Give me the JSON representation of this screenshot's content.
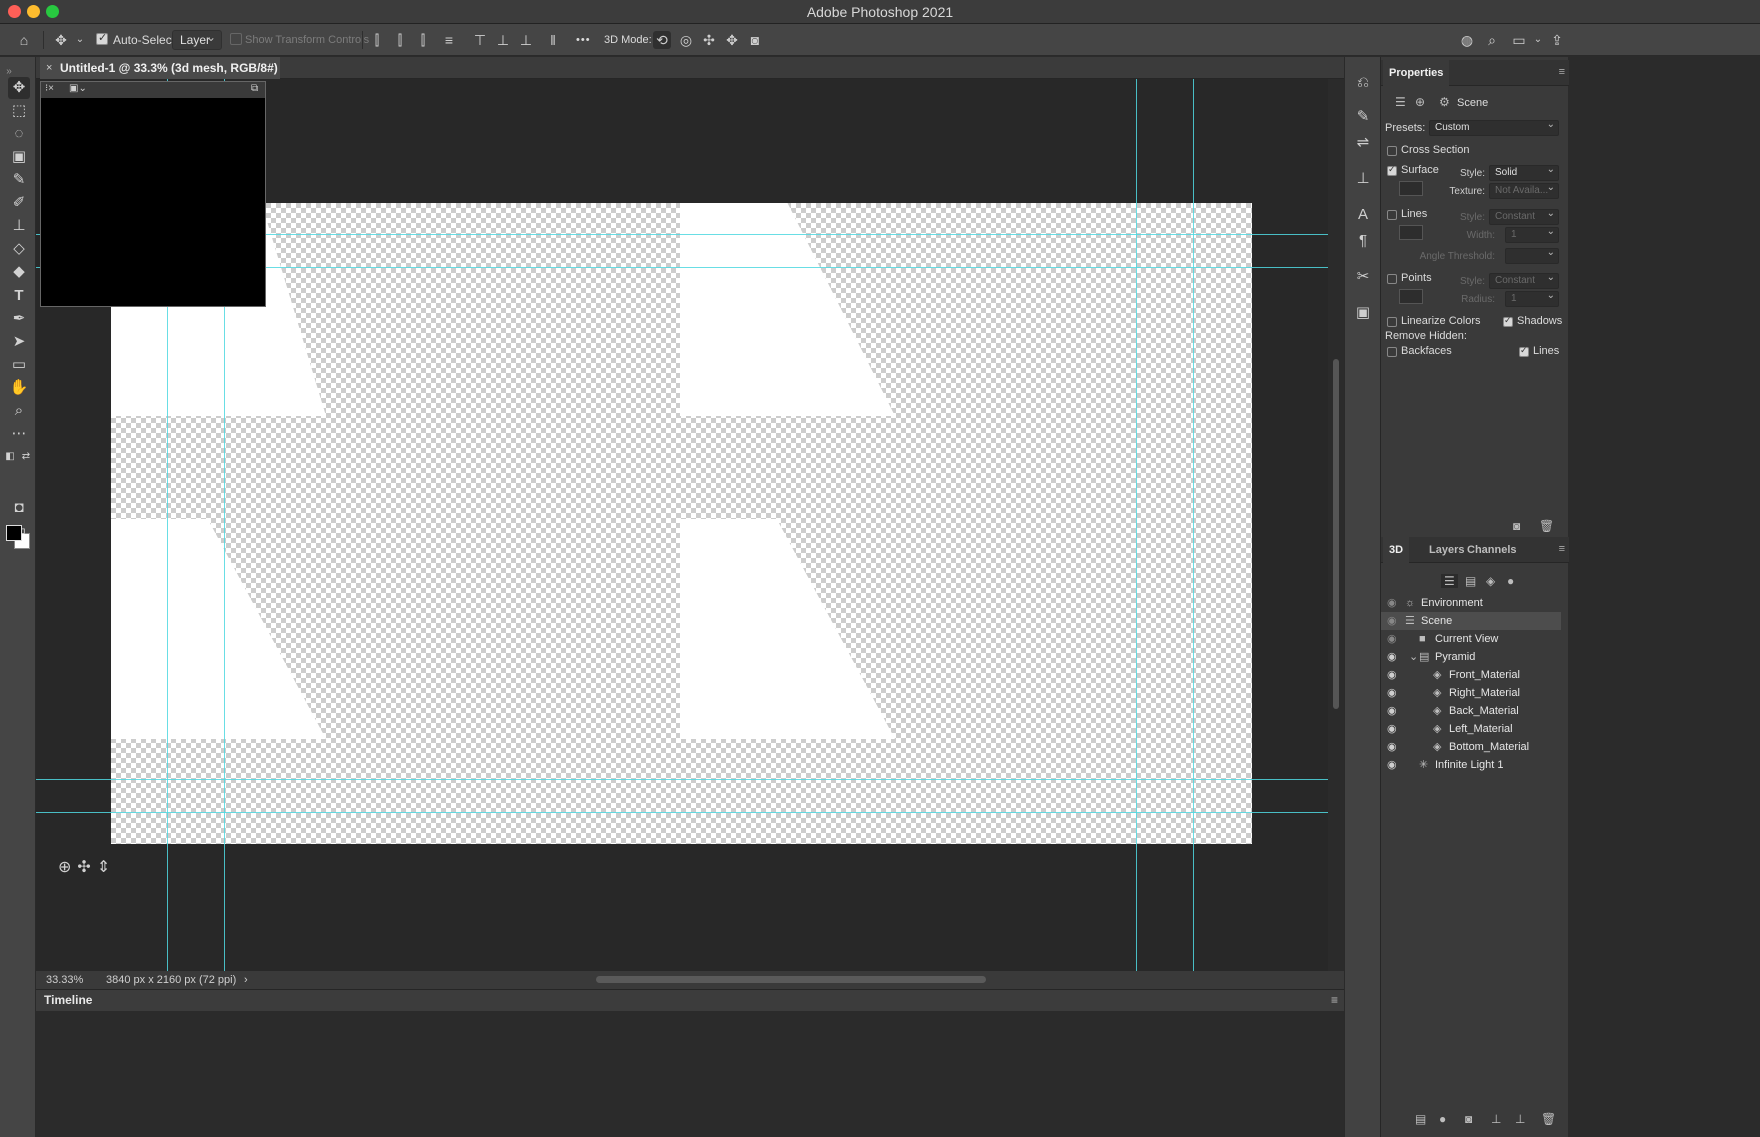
{
  "app_title": "Adobe Photoshop 2021",
  "options_bar": {
    "auto_select_label": "Auto-Select:",
    "auto_select_value": "Layer",
    "show_transform_label": "Show Transform Controls",
    "more_label": "•••",
    "mode_3d_label": "3D Mode:"
  },
  "document": {
    "tab_title": "Untitled-1 @ 33.3% (3d mesh, RGB/8#) *",
    "zoom": "33.33%",
    "size": "3840 px x 2160 px (72 ppi)",
    "status_arrow": "›"
  },
  "timeline": {
    "label": "Timeline",
    "menu": "≡"
  },
  "properties": {
    "tab": "Properties",
    "scene_label": "Scene",
    "presets_label": "Presets:",
    "presets_value": "Custom",
    "cross_section": "Cross Section",
    "surface": "Surface",
    "surface_style_label": "Style:",
    "surface_style_value": "Solid",
    "texture_label": "Texture:",
    "texture_value": "Not Availa...",
    "lines": "Lines",
    "lines_style_label": "Style:",
    "lines_style_value": "Constant",
    "width_label": "Width:",
    "width_value": "1",
    "angle_label": "Angle Threshold:",
    "points": "Points",
    "points_style_label": "Style:",
    "points_style_value": "Constant",
    "radius_label": "Radius:",
    "radius_value": "1",
    "linearize": "Linearize Colors",
    "shadows": "Shadows",
    "remove_hidden": "Remove Hidden:",
    "backfaces": "Backfaces",
    "lines_hidden": "Lines"
  },
  "panel_tabs": {
    "tab_3d": "3D",
    "tab_layers": "Layers",
    "tab_channels": "Channels"
  },
  "scene_tree": [
    {
      "label": "Environment",
      "icon": "☼",
      "indent": 0
    },
    {
      "label": "Scene",
      "icon": "☰",
      "indent": 0
    },
    {
      "label": "Current View",
      "icon": "■",
      "indent": 1
    },
    {
      "label": "Pyramid",
      "icon": "▤",
      "indent": 1
    },
    {
      "label": "Front_Material",
      "icon": "◈",
      "indent": 2
    },
    {
      "label": "Right_Material",
      "icon": "◈",
      "indent": 2
    },
    {
      "label": "Back_Material",
      "icon": "◈",
      "indent": 2
    },
    {
      "label": "Left_Material",
      "icon": "◈",
      "indent": 2
    },
    {
      "label": "Bottom_Material",
      "icon": "◈",
      "indent": 2
    },
    {
      "label": "Infinite Light 1",
      "icon": "✳",
      "indent": 1
    }
  ],
  "colors": {
    "guide": "#4fd8e0",
    "foreground": "#000000",
    "background": "#ffffff"
  }
}
